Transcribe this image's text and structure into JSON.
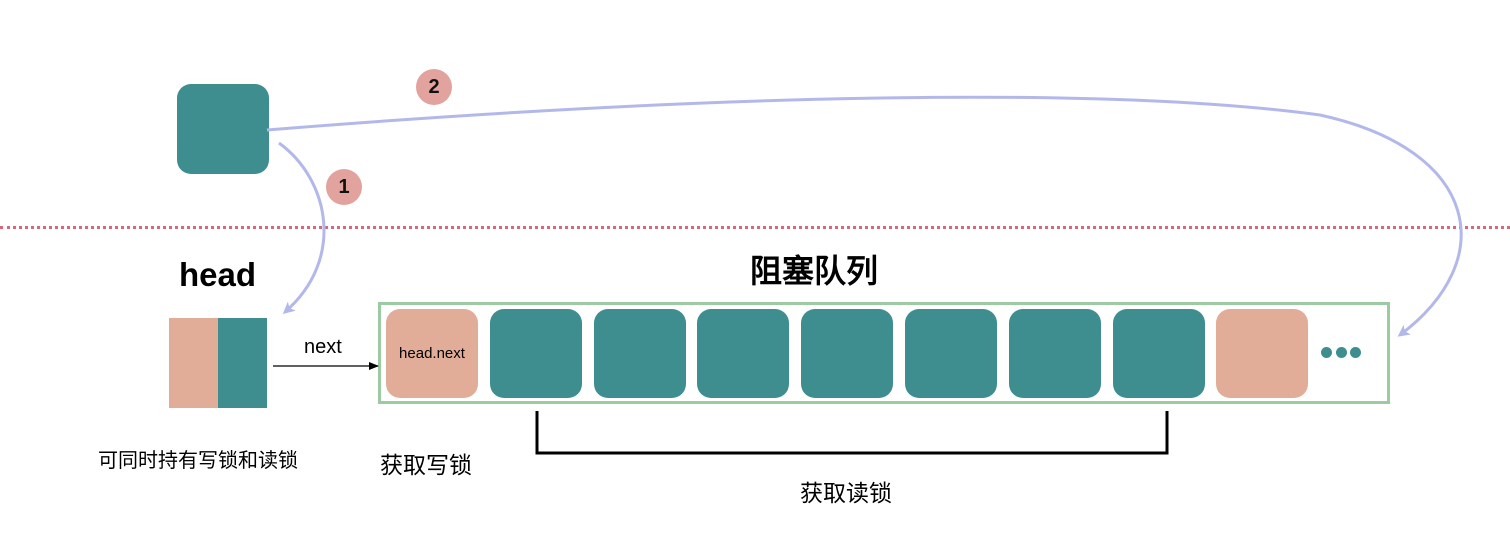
{
  "diagram": {
    "colors": {
      "node_teal": "#3f8e8f",
      "node_salmon": "#e2ad98",
      "arrow_lavender": "#b3b8ea",
      "divider_pink": "#d9677a",
      "queue_border_green": "#9ccaa2",
      "badge_pink": "#e2a29d"
    },
    "badges": [
      "1",
      "2"
    ],
    "head_label": "head",
    "queue_title": "阻塞队列",
    "next_label": "next",
    "head_next_label": "head.next",
    "ellipsis": "•••",
    "head_caption": "可同时持有写锁和读锁",
    "write_lock_caption": "获取写锁",
    "read_lock_caption": "获取读锁",
    "queue_nodes": [
      {
        "type": "salmon",
        "text": "head.next"
      },
      {
        "type": "teal",
        "text": ""
      },
      {
        "type": "teal",
        "text": ""
      },
      {
        "type": "teal",
        "text": ""
      },
      {
        "type": "teal",
        "text": ""
      },
      {
        "type": "teal",
        "text": ""
      },
      {
        "type": "teal",
        "text": ""
      },
      {
        "type": "teal",
        "text": ""
      },
      {
        "type": "salmon",
        "text": ""
      }
    ]
  }
}
